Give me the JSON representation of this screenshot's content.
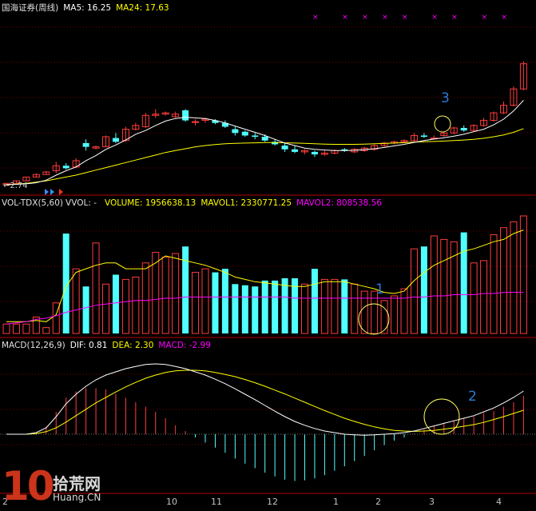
{
  "price_panel": {
    "stock_name": "国海证券(周线)",
    "ma5_label": "MA5: 16.25",
    "ma24_label": "MA24: 17.63",
    "low_marker": "←2.74",
    "colors": {
      "ma5": "#ffffff",
      "ma24": "#ffff00",
      "up": "#ff3c3c",
      "down": "#50ffff",
      "signal_x": "#ff00ff"
    }
  },
  "volume_panel": {
    "title": "VOL-TDX(5,60)",
    "vvol": "VVOL: -",
    "volume_label": "VOLUME: 1956638.13",
    "mavol1_label": "MAVOL1: 2330771.25",
    "mavol2_label": "MAVOL2: 808538.56",
    "colors": {
      "volume": "#ffff00",
      "mavol1": "#ffff00",
      "mavol2": "#ff00ff"
    }
  },
  "macd_panel": {
    "title": "MACD(12,26,9)",
    "dif_label": "DIF: 0.81",
    "dea_label": "DEA: 2.30",
    "macd_label": "MACD: -2.99",
    "colors": {
      "dif": "#ffffff",
      "dea": "#ffff00",
      "macd": "#ff00ff"
    }
  },
  "x_axis": {
    "labels": [
      "2",
      "10",
      "11",
      "12",
      "1",
      "2",
      "3",
      "4"
    ]
  },
  "annotations": {
    "a1": "1",
    "a2": "2",
    "a3": "3"
  },
  "watermark": {
    "logo_number": "10",
    "logo_text": "拾荒网",
    "logo_url": "Huang.CN"
  },
  "chart_data": {
    "type": "candlestick",
    "price": {
      "ohlc": [
        [
          2.7,
          2.8,
          2.7,
          2.8
        ],
        [
          2.8,
          3,
          2.8,
          3
        ],
        [
          3,
          3.3,
          3,
          3.3
        ],
        [
          3.3,
          3.6,
          3.3,
          3.5
        ],
        [
          3.5,
          3.8,
          3.5,
          3.7
        ],
        [
          3.8,
          4.5,
          3.6,
          4.2
        ],
        [
          4.2,
          4.4,
          3.9,
          4
        ],
        [
          4.1,
          4.8,
          4,
          4.6
        ],
        [
          6,
          6.3,
          5.4,
          5.7
        ],
        [
          5.6,
          5.8,
          5.5,
          5.7
        ],
        [
          5.7,
          6.6,
          5.7,
          6.5
        ],
        [
          6.4,
          6.8,
          6,
          6.1
        ],
        [
          6.2,
          7.3,
          6.1,
          7.1
        ],
        [
          7.1,
          7.6,
          7,
          7.4
        ],
        [
          7.3,
          8.4,
          7.2,
          8.2
        ],
        [
          8.2,
          8.7,
          8,
          8.3
        ],
        [
          8.3,
          8.5,
          8.2,
          8.4
        ],
        [
          8.1,
          8.5,
          8,
          8.3
        ],
        [
          8.6,
          8.7,
          7.7,
          7.8
        ],
        [
          7.7,
          7.9,
          7.4,
          7.7
        ],
        [
          7.8,
          8,
          7.6,
          7.9
        ],
        [
          7.8,
          7.9,
          7.5,
          7.6
        ],
        [
          7.6,
          7.8,
          7.2,
          7.3
        ],
        [
          7.1,
          7.3,
          6.6,
          6.8
        ],
        [
          6.9,
          7,
          6.5,
          6.6
        ],
        [
          6.6,
          6.8,
          6.3,
          6.5
        ],
        [
          6.5,
          6.7,
          6.1,
          6.2
        ],
        [
          6.1,
          6.3,
          5.8,
          5.9
        ],
        [
          5.8,
          6,
          5.3,
          5.5
        ],
        [
          5.5,
          5.8,
          5.2,
          5.3
        ],
        [
          5.3,
          5.5,
          5.1,
          5.4
        ],
        [
          5.3,
          5.4,
          4.9,
          5.1
        ],
        [
          5.1,
          5.4,
          5,
          5.2
        ],
        [
          5.2,
          5.5,
          5.1,
          5.4
        ],
        [
          5.5,
          5.6,
          5.3,
          5.4
        ],
        [
          5.3,
          5.6,
          5.2,
          5.5
        ],
        [
          5.4,
          5.7,
          5.3,
          5.6
        ],
        [
          5.5,
          5.9,
          5.4,
          5.8
        ],
        [
          5.8,
          6.1,
          5.7,
          6
        ],
        [
          6,
          6.2,
          5.9,
          6.1
        ],
        [
          6.1,
          6.3,
          6,
          6.2
        ],
        [
          6.2,
          6.8,
          6.1,
          6.6
        ],
        [
          6.6,
          6.8,
          6.4,
          6.5
        ],
        [
          6.4,
          6.6,
          6.3,
          6.4
        ],
        [
          6.6,
          6.9,
          6.5,
          6.8
        ],
        [
          6.8,
          7.3,
          6.7,
          7.2
        ],
        [
          7.2,
          7.4,
          6.9,
          7
        ],
        [
          7,
          7.5,
          6.9,
          7.4
        ],
        [
          7.4,
          8,
          7.3,
          7.8
        ],
        [
          7.8,
          8.5,
          7.7,
          8.4
        ],
        [
          8.4,
          9.3,
          8.3,
          9
        ],
        [
          9,
          10.5,
          8.9,
          10.3
        ],
        [
          10.3,
          12.5,
          10.2,
          12.3
        ]
      ],
      "ma5": [
        2.7,
        2.72,
        2.76,
        2.85,
        3.05,
        3.45,
        3.8,
        4.1,
        4.6,
        5,
        5.5,
        5.85,
        6.25,
        6.7,
        7,
        7.4,
        7.75,
        7.95,
        8.05,
        8,
        7.95,
        7.8,
        7.6,
        7.35,
        7.1,
        6.85,
        6.6,
        6.3,
        6,
        5.8,
        5.6,
        5.5,
        5.45,
        5.4,
        5.4,
        5.42,
        5.48,
        5.55,
        5.65,
        5.78,
        5.9,
        6.05,
        6.2,
        6.32,
        6.42,
        6.55,
        6.7,
        6.9,
        7.1,
        7.45,
        7.9,
        8.55,
        9.4
      ],
      "ma24": [
        2.7,
        2.74,
        2.8,
        2.9,
        3,
        3.15,
        3.3,
        3.45,
        3.65,
        3.85,
        4.05,
        4.25,
        4.45,
        4.65,
        4.85,
        5.05,
        5.25,
        5.4,
        5.55,
        5.7,
        5.8,
        5.88,
        5.94,
        5.98,
        6,
        6.02,
        6.04,
        6.04,
        6.02,
        6,
        5.98,
        5.95,
        5.92,
        5.9,
        5.9,
        5.9,
        5.92,
        5.94,
        5.97,
        6,
        6.03,
        6.07,
        6.1,
        6.13,
        6.16,
        6.2,
        6.24,
        6.3,
        6.38,
        6.5,
        6.65,
        6.85,
        7.15
      ]
    },
    "volume": {
      "values": [
        8,
        8,
        8,
        14,
        5,
        26,
        85,
        55,
        40,
        77,
        42,
        50,
        46,
        48,
        60,
        69,
        65,
        68,
        74,
        52,
        55,
        52,
        55,
        42,
        41,
        40,
        45,
        45,
        47,
        47,
        42,
        55,
        46,
        46,
        46,
        42,
        36,
        36,
        28,
        32,
        38,
        72,
        74,
        83,
        80,
        78,
        86,
        60,
        62,
        84,
        90,
        95,
        100
      ],
      "mavol1": [
        10,
        10,
        10,
        11,
        10,
        16,
        40,
        52,
        55,
        58,
        60,
        60,
        55,
        55,
        55,
        60,
        66,
        64,
        62,
        60,
        58,
        55,
        52,
        48,
        46,
        44,
        43,
        42,
        41,
        40,
        40,
        42,
        44,
        44,
        44,
        42,
        40,
        38,
        35,
        34,
        36,
        45,
        52,
        58,
        62,
        66,
        70,
        72,
        75,
        78,
        80,
        85,
        88
      ],
      "mavol2": [
        8,
        9,
        10,
        12,
        13,
        15,
        18,
        20,
        22,
        24,
        25,
        26,
        27,
        28,
        28,
        29,
        30,
        30,
        31,
        31,
        31,
        31,
        31,
        31,
        31,
        31,
        31,
        31,
        31,
        30,
        30,
        30,
        30,
        30,
        30,
        30,
        30,
        30,
        30,
        30,
        30,
        31,
        31,
        32,
        32,
        33,
        33,
        33,
        34,
        34,
        35,
        35,
        35
      ]
    },
    "macd": {
      "dif": [
        0,
        0,
        0,
        0.05,
        0.2,
        0.55,
        0.95,
        1.25,
        1.5,
        1.7,
        1.85,
        1.95,
        2.05,
        2.12,
        2.18,
        2.2,
        2.18,
        2.12,
        2.05,
        1.95,
        1.85,
        1.72,
        1.58,
        1.42,
        1.25,
        1.08,
        0.9,
        0.72,
        0.55,
        0.4,
        0.28,
        0.18,
        0.1,
        0.05,
        0,
        -0.02,
        -0.03,
        -0.02,
        0,
        0.02,
        0.05,
        0.1,
        0.18,
        0.26,
        0.34,
        0.42,
        0.5,
        0.58,
        0.7,
        0.82,
        0.98,
        1.15,
        1.35
      ],
      "dea": [
        0,
        0,
        0,
        0.02,
        0.08,
        0.2,
        0.38,
        0.58,
        0.78,
        0.98,
        1.15,
        1.32,
        1.48,
        1.62,
        1.75,
        1.85,
        1.93,
        1.98,
        2,
        2,
        1.98,
        1.93,
        1.87,
        1.8,
        1.71,
        1.61,
        1.5,
        1.38,
        1.26,
        1.13,
        1,
        0.87,
        0.74,
        0.62,
        0.5,
        0.4,
        0.31,
        0.23,
        0.17,
        0.12,
        0.1,
        0.09,
        0.1,
        0.12,
        0.16,
        0.2,
        0.25,
        0.3,
        0.37,
        0.46,
        0.55,
        0.65,
        0.75
      ],
      "hist": [
        0,
        0,
        0,
        0.06,
        0.24,
        0.7,
        1.14,
        1.34,
        1.44,
        1.44,
        1.4,
        1.26,
        1.14,
        1,
        0.86,
        0.7,
        0.5,
        0.28,
        0.1,
        -0.1,
        -0.26,
        -0.42,
        -0.58,
        -0.76,
        -0.92,
        -1.06,
        -1.2,
        -1.32,
        -1.42,
        -1.46,
        -1.44,
        -1.38,
        -1.28,
        -1.14,
        -1,
        -0.84,
        -0.68,
        -0.5,
        -0.34,
        -0.2,
        -0.1,
        0.02,
        0.16,
        0.28,
        0.36,
        0.44,
        0.5,
        0.56,
        0.66,
        0.72,
        0.86,
        1,
        1.2
      ]
    }
  }
}
